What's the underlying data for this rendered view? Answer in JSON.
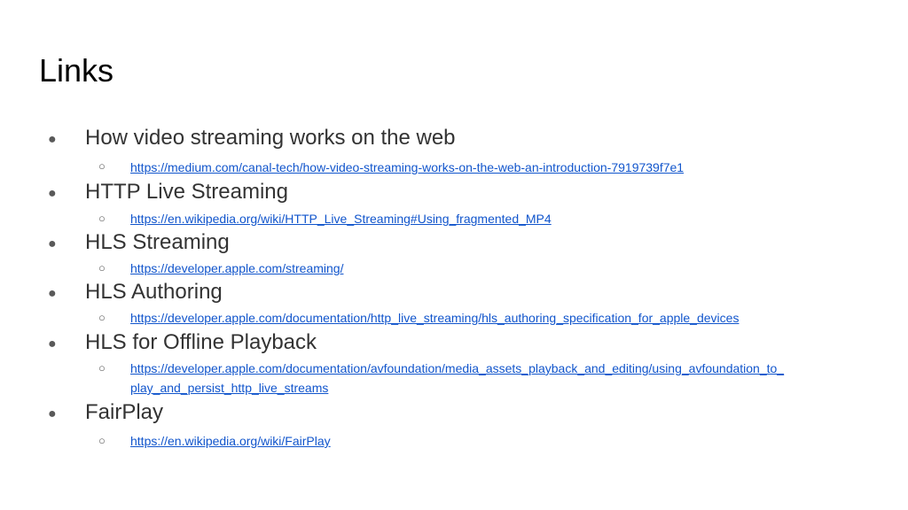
{
  "title": "Links",
  "bullet_main": "●",
  "bullet_sub": "○",
  "colors": {
    "link": "#1155cc",
    "text": "#333333",
    "title": "#000000"
  },
  "items": [
    {
      "label": "How video streaming works on the web",
      "link": "https://medium.com/canal-tech/how-video-streaming-works-on-the-web-an-introduction-7919739f7e1"
    },
    {
      "label": "HTTP Live Streaming",
      "link": "https://en.wikipedia.org/wiki/HTTP_Live_Streaming#Using_fragmented_MP4"
    },
    {
      "label": "HLS Streaming",
      "link": "https://developer.apple.com/streaming/"
    },
    {
      "label": "HLS Authoring",
      "link": "https://developer.apple.com/documentation/http_live_streaming/hls_authoring_specification_for_apple_devices"
    },
    {
      "label": "HLS for Offline Playback",
      "link_line1": "https://developer.apple.com/documentation/avfoundation/media_assets_playback_and_editing/using_avfoundation_to_",
      "link_line2": "play_and_persist_http_live_streams"
    },
    {
      "label": "FairPlay",
      "link": "https://en.wikipedia.org/wiki/FairPlay"
    }
  ]
}
